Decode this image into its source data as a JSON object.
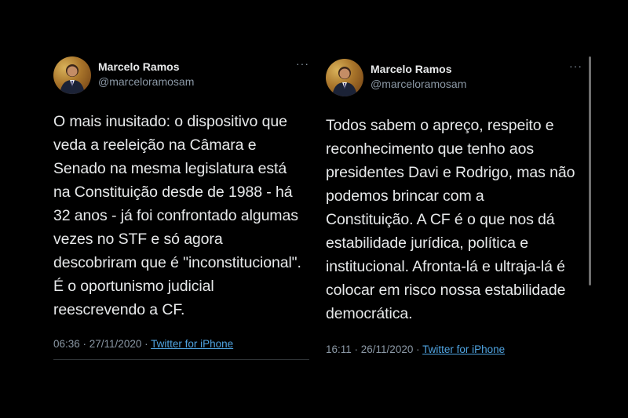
{
  "tweets": [
    {
      "author_name": "Marcelo Ramos",
      "handle": "@marceloramosam",
      "more_label": "···",
      "text": "O mais inusitado: o dispositivo que\nveda a reeleição na Câmara e\nSenado na mesma legislatura está\nna Constituição desde de 1988 - há\n32 anos - já foi confrontado algumas\nvezes no STF e só agora\ndescobriram que é \"inconstitucional\".\nÉ o oportunismo judicial\nreescrevendo a CF.",
      "timestamp": "06:36 · 27/11/2020 ·",
      "source": "Twitter for iPhone"
    },
    {
      "author_name": "Marcelo Ramos",
      "handle": "@marceloramosam",
      "more_label": "···",
      "text": "Todos sabem o apreço, respeito e\nreconhecimento que tenho aos\npresidentes Davi e Rodrigo, mas não\npodemos brincar com a\nConstituição. A CF é o que nos dá\nestabilidade jurídica, política e\ninstitucional. Afronta-lá e ultraja-lá é\ncolocar em risco nossa estabilidade\ndemocrática.",
      "timestamp": "16:11 · 26/11/2020 ·",
      "source": "Twitter for iPhone"
    }
  ],
  "colors": {
    "background": "#000000",
    "text": "#e7e9ea",
    "secondary": "#8b98a5",
    "link": "#4fa3e0"
  }
}
